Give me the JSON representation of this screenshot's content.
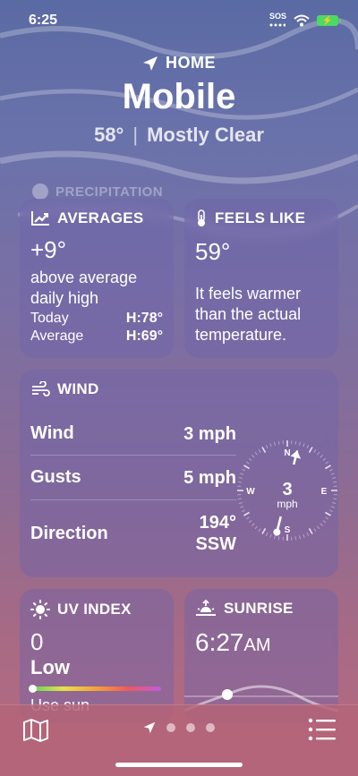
{
  "status": {
    "time": "6:25",
    "sos": "SOS"
  },
  "header": {
    "location_label": "HOME",
    "city": "Mobile",
    "temperature": "58°",
    "condition": "Mostly Clear"
  },
  "precipitation_peek": {
    "title": "PRECIPITATION"
  },
  "averages": {
    "title": "AVERAGES",
    "value": "+9°",
    "description": "above average daily high",
    "rows": [
      {
        "label": "Today",
        "value": "H:78°"
      },
      {
        "label": "Average",
        "value": "H:69°"
      }
    ]
  },
  "feels_like": {
    "title": "FEELS LIKE",
    "value": "59°",
    "description": "It feels warmer than the actual temperature."
  },
  "wind": {
    "title": "WIND",
    "rows": [
      {
        "label": "Wind",
        "value": "3 mph"
      },
      {
        "label": "Gusts",
        "value": "5 mph"
      },
      {
        "label": "Direction",
        "value": "194°",
        "value2": "SSW"
      }
    ],
    "compass": {
      "speed": "3",
      "unit": "mph",
      "n": "N",
      "e": "E",
      "s": "S",
      "w": "W",
      "direction_degrees": 194
    }
  },
  "uv_index": {
    "title": "UV INDEX",
    "value": "0",
    "level": "Low",
    "note": "Use sun"
  },
  "sunrise": {
    "title": "SUNRISE",
    "time": "6:27",
    "meridiem": "AM"
  },
  "colors": {
    "battery": "#4cd964",
    "card": "#6e64aa"
  }
}
